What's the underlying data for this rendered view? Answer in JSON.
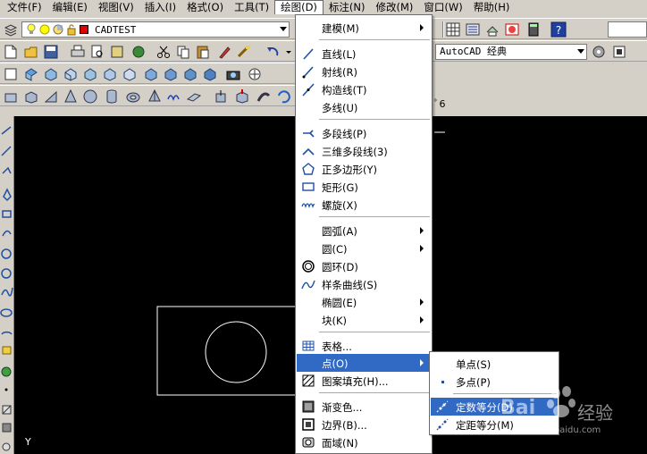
{
  "menubar": {
    "items": [
      "文件(F)",
      "编辑(E)",
      "视图(V)",
      "插入(I)",
      "格式(O)",
      "工具(T)",
      "绘图(D)",
      "标注(N)",
      "修改(M)",
      "窗口(W)",
      "帮助(H)"
    ]
  },
  "layer": {
    "name": "CADTEST",
    "color": "#e00000"
  },
  "workspace": {
    "name": "AutoCAD 经典"
  },
  "canvas": {
    "background": "#000000",
    "axis_label": "Y"
  },
  "draw_menu": {
    "items": [
      {
        "label": "建模(M)",
        "submenu": true
      },
      {
        "label": "直线(L)"
      },
      {
        "label": "射线(R)"
      },
      {
        "label": "构造线(T)"
      },
      {
        "label": "多线(U)"
      },
      {
        "label": "多段线(P)"
      },
      {
        "label": "三维多段线(3)"
      },
      {
        "label": "正多边形(Y)"
      },
      {
        "label": "矩形(G)"
      },
      {
        "label": "螺旋(X)"
      },
      {
        "label": "圆弧(A)",
        "submenu": true
      },
      {
        "label": "圆(C)",
        "submenu": true
      },
      {
        "label": "圆环(D)"
      },
      {
        "label": "样条曲线(S)"
      },
      {
        "label": "椭圆(E)",
        "submenu": true
      },
      {
        "label": "块(K)",
        "submenu": true
      },
      {
        "label": "表格..."
      },
      {
        "label": "点(O)",
        "submenu": true,
        "highlighted": true
      },
      {
        "label": "图案填充(H)..."
      },
      {
        "label": "渐变色..."
      },
      {
        "label": "边界(B)..."
      },
      {
        "label": "面域(N)"
      }
    ]
  },
  "point_menu": {
    "items": [
      {
        "label": "单点(S)"
      },
      {
        "label": "多点(P)"
      },
      {
        "label": "定数等分(D)",
        "highlighted": true
      },
      {
        "label": "定距等分(M)"
      }
    ]
  },
  "watermark": {
    "text": "Bai",
    "text2": "经验",
    "url": "jingyan.baidu.com"
  },
  "colors": {
    "highlight": "#316ac5",
    "toolbar": "#d4d0c8"
  }
}
